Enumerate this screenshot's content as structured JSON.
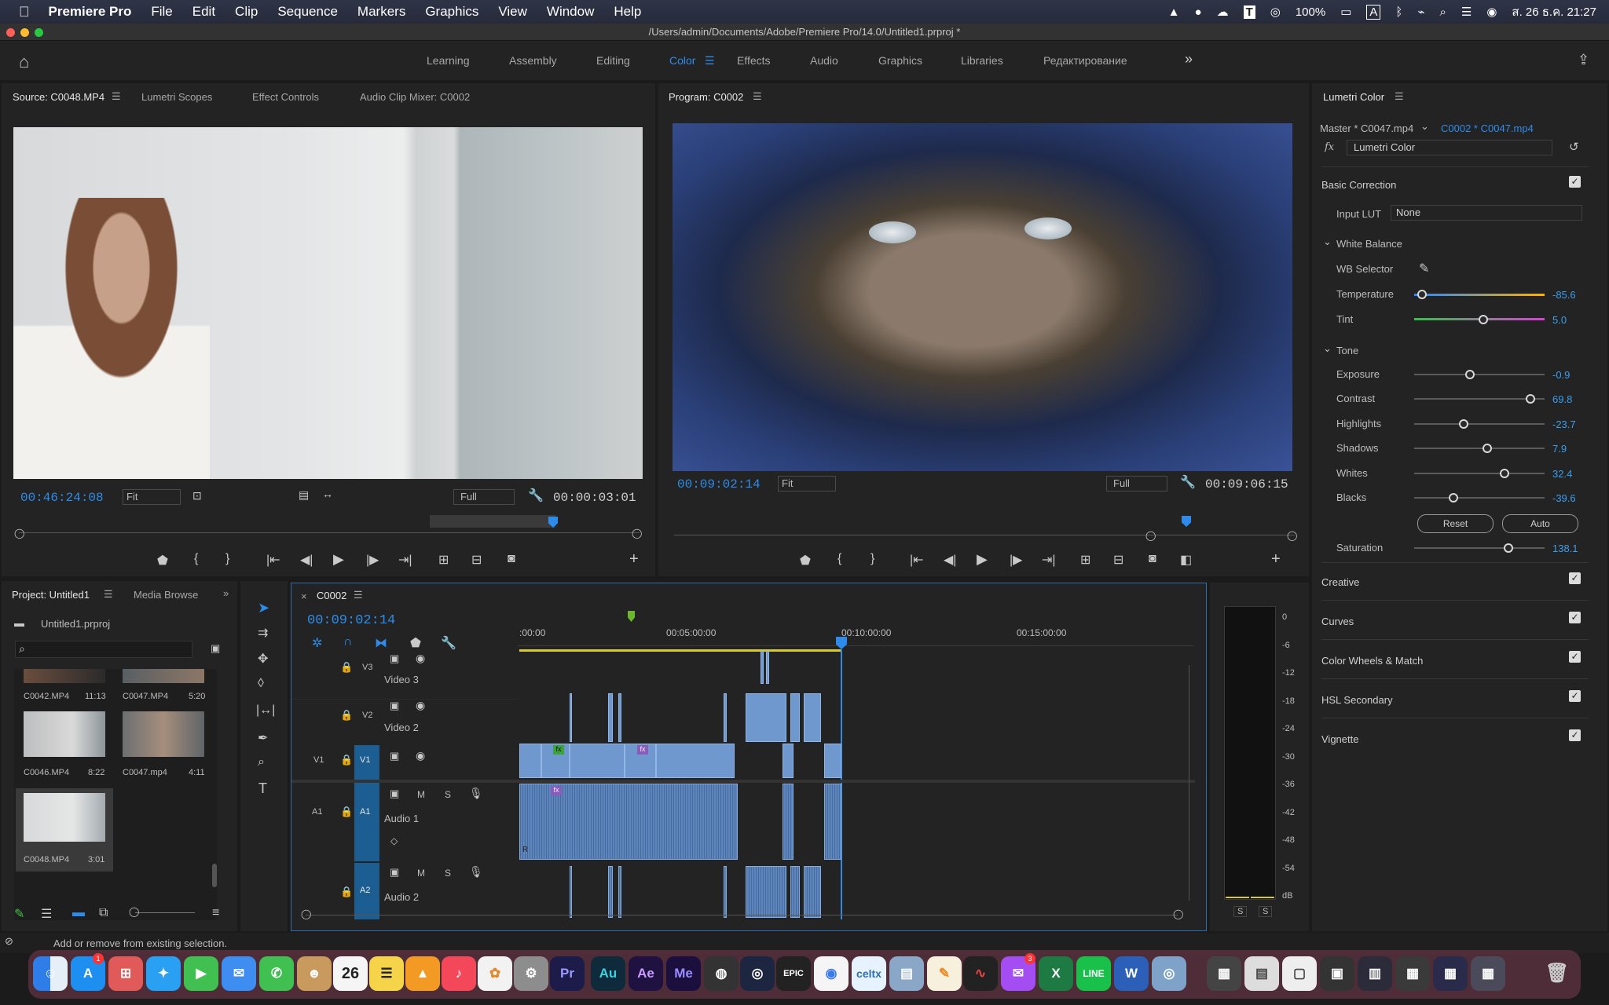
{
  "menubar": {
    "app": "Premiere Pro",
    "items": [
      "File",
      "Edit",
      "Clip",
      "Sequence",
      "Markers",
      "Graphics",
      "View",
      "Window",
      "Help"
    ],
    "battery": "100%",
    "clock": "ส. 26 ธ.ค. 21:27"
  },
  "window": {
    "title": "/Users/admin/Documents/Adobe/Premiere Pro/14.0/Untitled1.prproj *"
  },
  "workspaces": {
    "tabs": [
      "Learning",
      "Assembly",
      "Editing",
      "Color",
      "Effects",
      "Audio",
      "Graphics",
      "Libraries",
      "Редактирование"
    ],
    "active": "Color",
    "overflow": "»"
  },
  "source": {
    "tabs": [
      "Source: C0048.MP4",
      "Lumetri Scopes",
      "Effect Controls",
      "Audio Clip Mixer: C0002"
    ],
    "timecode": "00:46:24:08",
    "fit": "Fit",
    "quality": "Full",
    "duration": "00:00:03:01"
  },
  "program": {
    "tab": "Program: C0002",
    "timecode": "00:09:02:14",
    "fit": "Fit",
    "quality": "Full",
    "duration": "00:09:06:15"
  },
  "lumetri": {
    "tab": "Lumetri Color",
    "master": "Master * C0047.mp4",
    "clip": "C0002 * C0047.mp4",
    "fx_label": "fx",
    "effect": "Lumetri Color",
    "basic": "Basic Correction",
    "input_lut_label": "Input LUT",
    "input_lut": "None",
    "white_balance": "White Balance",
    "wb_selector": "WB Selector",
    "tone": "Tone",
    "sliders": [
      {
        "label": "Temperature",
        "value": "-85.6",
        "pos": 0.06
      },
      {
        "label": "Tint",
        "value": "5.0",
        "pos": 0.53
      },
      {
        "label": "Exposure",
        "value": "-0.9",
        "pos": 0.43
      },
      {
        "label": "Contrast",
        "value": "69.8",
        "pos": 0.89
      },
      {
        "label": "Highlights",
        "value": "-23.7",
        "pos": 0.38
      },
      {
        "label": "Shadows",
        "value": "7.9",
        "pos": 0.56
      },
      {
        "label": "Whites",
        "value": "32.4",
        "pos": 0.69
      },
      {
        "label": "Blacks",
        "value": "-39.6",
        "pos": 0.3
      }
    ],
    "reset": "Reset",
    "auto": "Auto",
    "saturation": {
      "label": "Saturation",
      "value": "138.1",
      "pos": 0.72
    },
    "sections": [
      "Creative",
      "Curves",
      "Color Wheels & Match",
      "HSL Secondary",
      "Vignette"
    ]
  },
  "project": {
    "tabs": [
      "Project: Untitled1",
      "Media Browse"
    ],
    "file": "Untitled1.prproj",
    "search_placeholder": "",
    "items": [
      {
        "name": "C0042.MP4",
        "dur": "11:13"
      },
      {
        "name": "C0047.MP4",
        "dur": "5:20"
      },
      {
        "name": "C0046.MP4",
        "dur": "8:22"
      },
      {
        "name": "C0047.mp4",
        "dur": "4:11"
      },
      {
        "name": "C0048.MP4",
        "dur": "3:01"
      }
    ]
  },
  "timeline": {
    "tab": "C0002",
    "timecode": "00:09:02:14",
    "ruler": [
      ":00:00",
      "00:05:00:00",
      "00:10:00:00",
      "00:15:00:00"
    ],
    "tracks": {
      "v3": {
        "id": "V3",
        "name": "Video 3"
      },
      "v2": {
        "id": "V2",
        "name": "Video 2"
      },
      "v1": {
        "src": "V1",
        "id": "V1"
      },
      "a1": {
        "src": "A1",
        "id": "A1",
        "name": "Audio 1"
      },
      "a2": {
        "id": "A2",
        "name": "Audio 2"
      }
    },
    "m": "M",
    "s": "S",
    "fx": "fx",
    "r": "R"
  },
  "meter": {
    "scale": [
      "0",
      "-6",
      "-12",
      "-18",
      "-24",
      "-30",
      "-36",
      "-42",
      "-48",
      "-54",
      "dB"
    ],
    "solo": [
      "S",
      "S"
    ]
  },
  "status": {
    "text": "Add or remove from existing selection."
  },
  "dock": {
    "calendar_day": "26",
    "apps": [
      {
        "label": "Pr",
        "color": "#1d1b4a",
        "fg": "#9a9bff"
      },
      {
        "label": "Au",
        "color": "#0f2a3b",
        "fg": "#3ad4e0"
      },
      {
        "label": "Ae",
        "color": "#1f1240",
        "fg": "#c79bff"
      },
      {
        "label": "Me",
        "color": "#1b0f3e",
        "fg": "#9b8cff"
      }
    ],
    "badges": [
      "1",
      "3"
    ]
  },
  "colors": {
    "accent": "#2d8ceb",
    "bg": "#232323",
    "panel_border": "#151515",
    "clip": "#6f98cf"
  }
}
